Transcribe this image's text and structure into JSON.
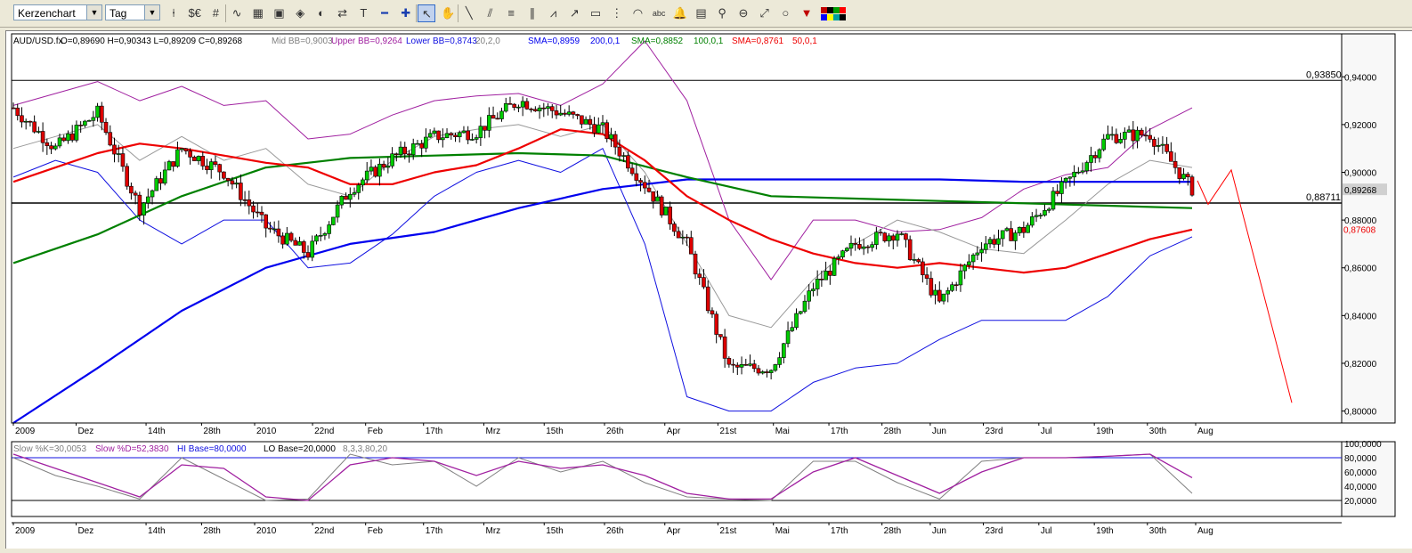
{
  "toolbar": {
    "chart_type": "Kerzenchart",
    "interval": "Tag",
    "buttons": [
      "candles-icon",
      "currency-icon",
      "grid-icon",
      "chart-line-icon",
      "table-icon",
      "image-icon",
      "eraser-icon",
      "palette-icon",
      "arrows-icon",
      "text-icon",
      "minus-icon",
      "plus-icon",
      "cursor-icon",
      "hand-icon",
      "line-icon",
      "parallel-icon",
      "fibonacci-icon",
      "channel-icon",
      "fan-icon",
      "arrow-icon",
      "rectangle-icon",
      "cycle-icon",
      "arc-icon",
      "text-tool-icon",
      "bell-icon",
      "calculator-icon",
      "zoom-icon",
      "zoom-out-icon",
      "trend-icon",
      "circle-icon",
      "down-arrow-icon",
      "colors-icon"
    ],
    "text_tool_label": "abc",
    "colors": [
      "#c00000",
      "#000000",
      "#00a000",
      "#ff0000",
      "#0000ff",
      "#ffff00",
      "#00a0a0",
      "#000000"
    ]
  },
  "main_chart": {
    "legend": {
      "symbol": "AUD/USD.fx",
      "ohlc": "O=0,89690 H=0,90343 L=0,89209 C=0,89268",
      "mid_bb": "Mid BB=0,9003",
      "upper_bb": "Upper BB=0,9264",
      "lower_bb": "Lower BB=0,8743",
      "bb_params": "20,2,0",
      "sma200": "SMA=0,8959",
      "sma200_params": "200,0,1",
      "sma100": "SMA=0,8852",
      "sma100_params": "100,0,1",
      "sma50": "SMA=0,8761",
      "sma50_params": "50,0,1"
    },
    "price_labels": {
      "resistance": "0,93850",
      "support": "0,88711",
      "last_price": "0,89268",
      "sma50_label": "0,87608"
    },
    "y_ticks": [
      "0,94000",
      "0,92000",
      "0,90000",
      "0,88000",
      "0,86000",
      "0,84000",
      "0,82000",
      "0,80000"
    ],
    "x_ticks": [
      "2009",
      "Dez",
      "14th",
      "28th",
      "2010",
      "22nd",
      "Feb",
      "17th",
      "Mrz",
      "15th",
      "26th",
      "Apr",
      "21st",
      "Mai",
      "17th",
      "28th",
      "Jun",
      "23rd",
      "Jul",
      "19th",
      "30th",
      "Aug"
    ]
  },
  "stoch_panel": {
    "legend": {
      "k": "Slow %K=30,0053",
      "d": "Slow %D=52,3830",
      "hi": "HI Base=80,0000",
      "lo": "LO Base=20,0000",
      "params": "8,3,3,80,20"
    },
    "y_ticks": [
      "100,0000",
      "80,0000",
      "60,0000",
      "40,0000",
      "20,0000"
    ],
    "x_ticks": [
      "2009",
      "Dez",
      "14th",
      "28th",
      "2010",
      "22nd",
      "Feb",
      "17th",
      "Mrz",
      "15th",
      "26th",
      "Apr",
      "21st",
      "Mai",
      "17th",
      "28th",
      "Jun",
      "23rd",
      "Jul",
      "19th",
      "30th",
      "Aug"
    ]
  },
  "chart_data": {
    "type": "line",
    "title": "AUD/USD.fx",
    "ylim": [
      0.795,
      0.958
    ],
    "horizontal_levels": [
      0.9385,
      0.88711
    ],
    "series": [
      {
        "name": "Upper BB",
        "color": "#a020a0",
        "x": [
          0,
          10,
          20,
          30,
          40,
          50,
          60,
          70,
          80,
          90,
          100,
          110,
          120,
          130,
          140,
          150,
          160,
          170,
          180,
          190,
          200,
          210,
          220,
          230,
          240,
          250,
          260,
          270,
          280
        ],
        "values": [
          0.928,
          0.933,
          0.938,
          0.93,
          0.936,
          0.928,
          0.93,
          0.914,
          0.916,
          0.924,
          0.93,
          0.932,
          0.933,
          0.928,
          0.937,
          0.955,
          0.93,
          0.88,
          0.855,
          0.88,
          0.88,
          0.875,
          0.876,
          0.881,
          0.893,
          0.899,
          0.902,
          0.918,
          0.927
        ]
      },
      {
        "name": "Mid BB",
        "color": "#999999",
        "x": [
          0,
          10,
          20,
          30,
          40,
          50,
          60,
          70,
          80,
          90,
          100,
          110,
          120,
          130,
          140,
          150,
          160,
          170,
          180,
          190,
          200,
          210,
          220,
          230,
          240,
          250,
          260,
          270,
          280
        ],
        "values": [
          0.91,
          0.915,
          0.92,
          0.905,
          0.915,
          0.905,
          0.91,
          0.895,
          0.89,
          0.905,
          0.915,
          0.918,
          0.92,
          0.915,
          0.92,
          0.9,
          0.87,
          0.84,
          0.835,
          0.855,
          0.87,
          0.88,
          0.875,
          0.868,
          0.866,
          0.88,
          0.895,
          0.905,
          0.902
        ]
      },
      {
        "name": "Lower BB",
        "color": "#1010e0",
        "x": [
          0,
          10,
          20,
          30,
          40,
          50,
          60,
          70,
          80,
          90,
          100,
          110,
          120,
          130,
          140,
          150,
          160,
          170,
          180,
          190,
          200,
          210,
          220,
          230,
          240,
          250,
          260,
          270,
          280
        ],
        "values": [
          0.898,
          0.905,
          0.9,
          0.88,
          0.87,
          0.88,
          0.88,
          0.86,
          0.862,
          0.874,
          0.89,
          0.9,
          0.905,
          0.9,
          0.91,
          0.87,
          0.806,
          0.8,
          0.8,
          0.812,
          0.818,
          0.82,
          0.83,
          0.838,
          0.838,
          0.838,
          0.848,
          0.865,
          0.873
        ]
      },
      {
        "name": "SMA 200",
        "color": "#0000ee",
        "x": [
          0,
          20,
          40,
          60,
          80,
          100,
          120,
          140,
          160,
          180,
          200,
          220,
          240,
          260,
          280
        ],
        "values": [
          0.795,
          0.818,
          0.842,
          0.86,
          0.87,
          0.875,
          0.885,
          0.893,
          0.897,
          0.897,
          0.897,
          0.897,
          0.896,
          0.896,
          0.896
        ]
      },
      {
        "name": "SMA 100",
        "color": "#008000",
        "x": [
          0,
          20,
          40,
          60,
          80,
          100,
          120,
          140,
          160,
          180,
          200,
          220,
          240,
          260,
          280
        ],
        "values": [
          0.862,
          0.874,
          0.89,
          0.902,
          0.906,
          0.907,
          0.908,
          0.907,
          0.898,
          0.89,
          0.889,
          0.888,
          0.887,
          0.886,
          0.885
        ]
      },
      {
        "name": "SMA 50",
        "color": "#ee0000",
        "x": [
          0,
          10,
          20,
          30,
          40,
          50,
          60,
          70,
          80,
          90,
          100,
          110,
          120,
          130,
          140,
          150,
          160,
          170,
          180,
          190,
          200,
          210,
          220,
          230,
          240,
          250,
          260,
          270,
          280
        ],
        "values": [
          0.896,
          0.902,
          0.908,
          0.912,
          0.91,
          0.907,
          0.904,
          0.902,
          0.895,
          0.895,
          0.9,
          0.903,
          0.91,
          0.918,
          0.916,
          0.905,
          0.89,
          0.88,
          0.872,
          0.866,
          0.862,
          0.86,
          0.862,
          0.86,
          0.858,
          0.86,
          0.866,
          0.872,
          0.876
        ]
      },
      {
        "name": "Close",
        "color": "#000000",
        "x": [
          0,
          10,
          20,
          30,
          40,
          50,
          60,
          70,
          80,
          90,
          100,
          110,
          120,
          130,
          140,
          150,
          160,
          170,
          180,
          190,
          200,
          210,
          220,
          230,
          240,
          250,
          260,
          270,
          280
        ],
        "values": [
          0.927,
          0.91,
          0.925,
          0.885,
          0.91,
          0.9,
          0.877,
          0.866,
          0.893,
          0.906,
          0.915,
          0.917,
          0.93,
          0.925,
          0.918,
          0.895,
          0.87,
          0.818,
          0.818,
          0.852,
          0.87,
          0.875,
          0.845,
          0.87,
          0.876,
          0.895,
          0.915,
          0.916,
          0.893
        ]
      }
    ],
    "stochastic": {
      "ylim": [
        0,
        100
      ],
      "x": [
        0,
        10,
        20,
        30,
        40,
        50,
        60,
        70,
        80,
        90,
        100,
        110,
        120,
        130,
        140,
        150,
        160,
        170,
        180,
        190,
        200,
        210,
        220,
        230,
        240,
        250,
        260,
        270,
        280
      ],
      "k": [
        80,
        55,
        40,
        22,
        80,
        50,
        20,
        22,
        85,
        70,
        75,
        40,
        80,
        60,
        75,
        45,
        25,
        22,
        20,
        75,
        75,
        45,
        22,
        75,
        80,
        80,
        82,
        85,
        30
      ],
      "d": [
        85,
        65,
        45,
        25,
        70,
        65,
        25,
        20,
        70,
        80,
        75,
        55,
        75,
        65,
        70,
        55,
        30,
        22,
        22,
        60,
        80,
        55,
        30,
        60,
        80,
        80,
        82,
        85,
        52
      ],
      "hi_base": 80,
      "lo_base": 20
    }
  }
}
